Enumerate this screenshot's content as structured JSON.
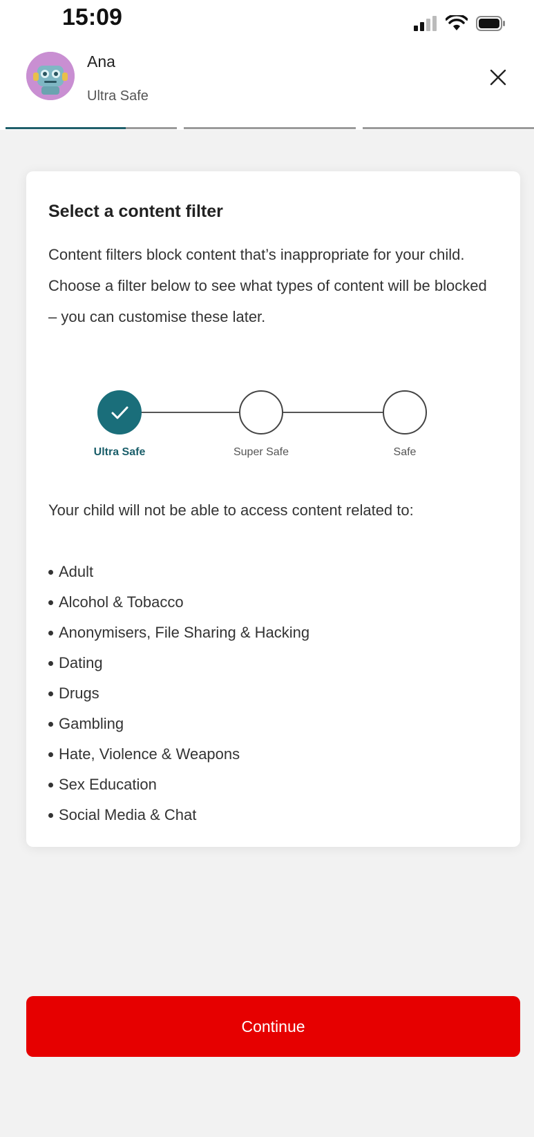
{
  "status_bar": {
    "time": "15:09",
    "icons": [
      "signal-icon",
      "wifi-icon",
      "battery-icon"
    ]
  },
  "header": {
    "user_name": "Ana",
    "user_filter": "Ultra Safe",
    "avatar_icon": "robot-avatar-icon",
    "close_icon": "close-icon"
  },
  "progress": {
    "total_steps": 3,
    "current_step": 1
  },
  "card": {
    "title": "Select a content filter",
    "description": "Content filters block content that’s inappropriate for your child. Choose a filter below to see what types of content will be blocked – you can customise these later.",
    "filters": [
      {
        "label": "Ultra Safe",
        "selected": true
      },
      {
        "label": "Super Safe",
        "selected": false
      },
      {
        "label": "Safe",
        "selected": false
      }
    ],
    "access_text": "Your child will not be able to access content related to:",
    "blocked_categories": [
      "Adult",
      "Alcohol & Tobacco",
      "Anonymisers, File Sharing & Hacking",
      "Dating",
      "Drugs",
      "Gambling",
      "Hate, Violence & Weapons",
      "Sex Education",
      "Social Media & Chat"
    ]
  },
  "actions": {
    "continue_label": "Continue"
  },
  "colors": {
    "primary_red": "#e60000",
    "accent_teal": "#1a6e7a",
    "background": "#f2f2f2"
  }
}
